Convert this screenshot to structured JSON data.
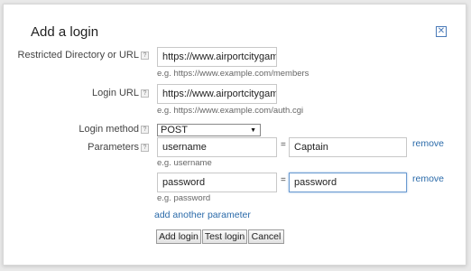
{
  "dialog": {
    "title": "Add a login",
    "close_glyph": "✕"
  },
  "fields": {
    "restricted_url": {
      "label": "Restricted Directory or URL",
      "value": "https://www.airportcitygame.c",
      "hint": "e.g. https://www.example.com/members"
    },
    "login_url": {
      "label": "Login URL",
      "value": "https://www.airportcitygame.c",
      "hint": "e.g. https://www.example.com/auth.cgi"
    },
    "login_method": {
      "label": "Login method",
      "value": "POST"
    },
    "parameters": {
      "label": "Parameters",
      "rows": [
        {
          "name": "username",
          "value": "Captain",
          "hint": "e.g. username",
          "remove": "remove"
        },
        {
          "name": "password",
          "value": "password",
          "hint": "e.g. password",
          "remove": "remove"
        }
      ],
      "equals": "="
    }
  },
  "help_glyph": "?",
  "links": {
    "add_parameter": "add another parameter"
  },
  "buttons": {
    "add_login": "Add login",
    "test_login": "Test login",
    "cancel": "Cancel"
  },
  "colors": {
    "link": "#2a6aa9",
    "focus_border": "#6a9ad0",
    "close_icon": "#4a7ab8"
  }
}
